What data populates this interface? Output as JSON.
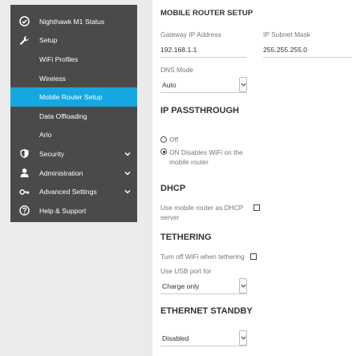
{
  "sidebar": {
    "items": [
      {
        "label": "Nighthawk M1 Status",
        "icon": "check-circle-icon"
      },
      {
        "label": "Setup",
        "icon": "wrench-icon"
      },
      {
        "label": "WiFi Profiles"
      },
      {
        "label": "Wireless"
      },
      {
        "label": "Mobile Router Setup",
        "active": true
      },
      {
        "label": "Data Offloading"
      },
      {
        "label": "Arlo"
      },
      {
        "label": "Security",
        "icon": "shield-icon"
      },
      {
        "label": "Administration",
        "icon": "person-icon"
      },
      {
        "label": "Advanced Settings",
        "icon": "key-icon"
      },
      {
        "label": "Help & Support",
        "icon": "help-icon"
      }
    ],
    "active_color": "#17a7e0",
    "bg_color": "#4a4a4a"
  },
  "mobile_router_setup": {
    "title": "MOBILE ROUTER SETUP",
    "gateway_label": "Gateway IP Address",
    "gateway_value": "192.168.1.1",
    "subnet_label": "IP Subnet Mask",
    "subnet_value": "255.255.255.0",
    "dns_label": "DNS Mode",
    "dns_value": "Auto"
  },
  "ip_passthrough": {
    "title": "IP PASSTHROUGH",
    "option_off": "Off",
    "option_on_line1": "ON Disables WiFi on the",
    "option_on_line2": "mobile router",
    "selected": "on"
  },
  "dhcp": {
    "title": "DHCP",
    "label_line1": "Use mobile router as DHCP",
    "label_line2": "server",
    "checked": false
  },
  "tethering": {
    "title": "TETHERING",
    "wifi_off_label": "Turn off WiFi when tethering",
    "wifi_off_checked": false,
    "usb_label": "Use USB port for",
    "usb_value": "Charge only"
  },
  "ethernet_standby": {
    "title": "ETHERNET STANDBY",
    "value": "Disabled"
  }
}
